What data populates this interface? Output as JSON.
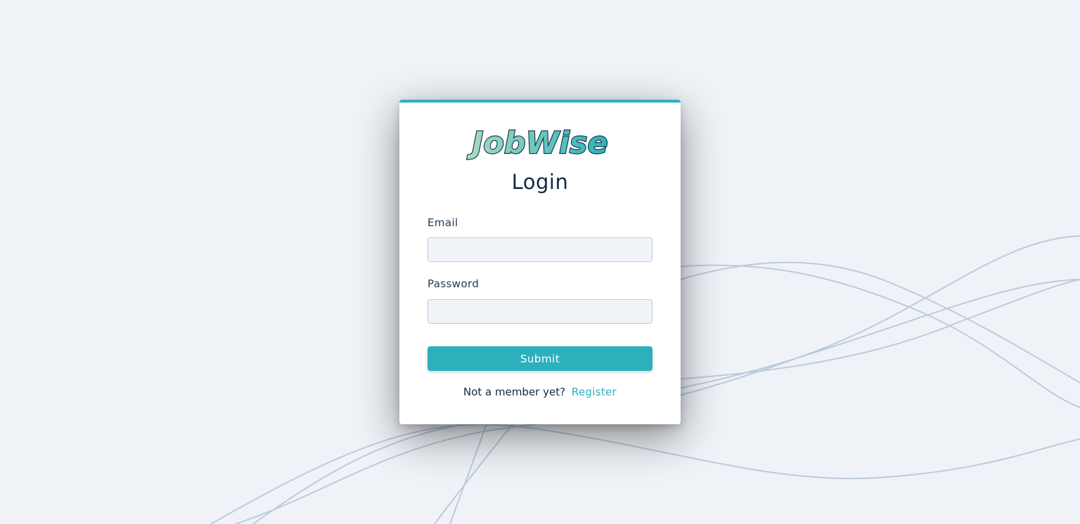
{
  "brand": {
    "logo_text": "JobWise",
    "accent_color": "#2cb1bc",
    "logo_gradient_start": "#a8dcc0",
    "logo_gradient_end": "#2cb1bc"
  },
  "login": {
    "title": "Login",
    "email_label": "Email",
    "email_value": "",
    "password_label": "Password",
    "password_value": "",
    "submit_label": "Submit",
    "footer_text": "Not a member yet?",
    "register_link": "Register"
  },
  "colors": {
    "background": "#eff3f8",
    "card": "#ffffff",
    "text_dark": "#102a43",
    "input_bg": "#f0f4f8",
    "input_border": "#bcccdc",
    "wave_lines": "#b9cadb"
  }
}
